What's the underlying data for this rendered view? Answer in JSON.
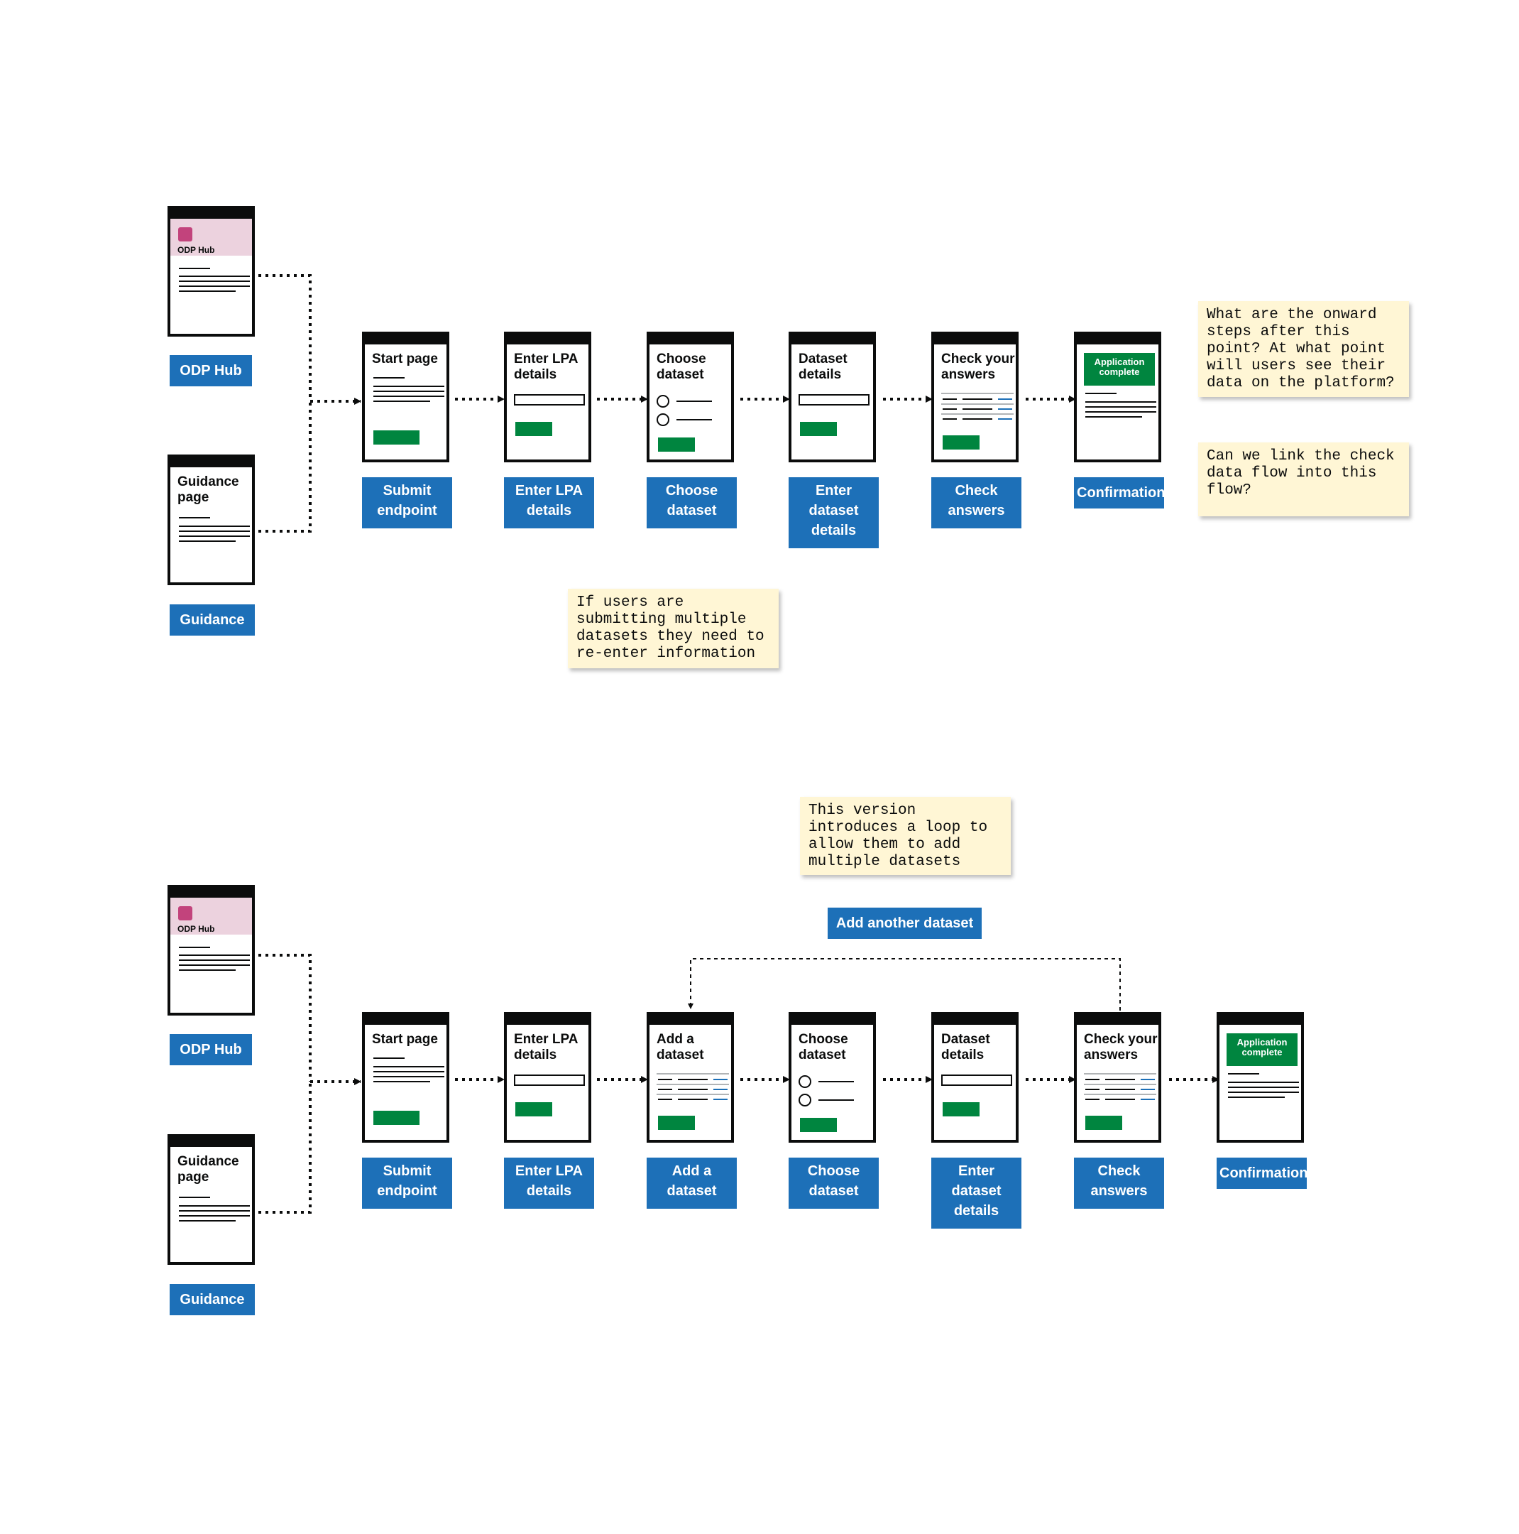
{
  "flow_top": {
    "entry_points": [
      {
        "screen_title": "ODP Hub",
        "label": "ODP Hub"
      },
      {
        "screen_title": "Guidance page",
        "label": "Guidance"
      }
    ],
    "steps": [
      {
        "screen_title": "Start page",
        "label": "Submit endpoint"
      },
      {
        "screen_title": "Enter LPA details",
        "label": "Enter LPA details"
      },
      {
        "screen_title": "Choose dataset",
        "label": "Choose dataset"
      },
      {
        "screen_title": "Dataset details",
        "label": "Enter dataset details"
      },
      {
        "screen_title": "Check your answers",
        "label": "Check answers"
      },
      {
        "screen_title": "Application complete",
        "label": "Confirmation"
      }
    ],
    "notes": [
      "What are the onward steps after this point? At what point will users see their data on the platform?",
      "Can we link the check data flow into this flow?",
      "If users are submitting multiple datasets they need to re-enter information"
    ]
  },
  "flow_bottom": {
    "entry_points": [
      {
        "screen_title": "ODP Hub",
        "label": "ODP Hub"
      },
      {
        "screen_title": "Guidance page",
        "label": "Guidance"
      }
    ],
    "steps": [
      {
        "screen_title": "Start page",
        "label": "Submit endpoint"
      },
      {
        "screen_title": "Enter LPA details",
        "label": "Enter LPA details"
      },
      {
        "screen_title": "Add a dataset",
        "label": "Add a dataset"
      },
      {
        "screen_title": "Choose dataset",
        "label": "Choose dataset"
      },
      {
        "screen_title": "Dataset details",
        "label": "Enter dataset details"
      },
      {
        "screen_title": "Check your answers",
        "label": "Check answers"
      },
      {
        "screen_title": "Application complete",
        "label": "Confirmation"
      }
    ],
    "loop_label": "Add another dataset",
    "notes": [
      "This version introduces a loop to allow them to add multiple datasets"
    ]
  }
}
